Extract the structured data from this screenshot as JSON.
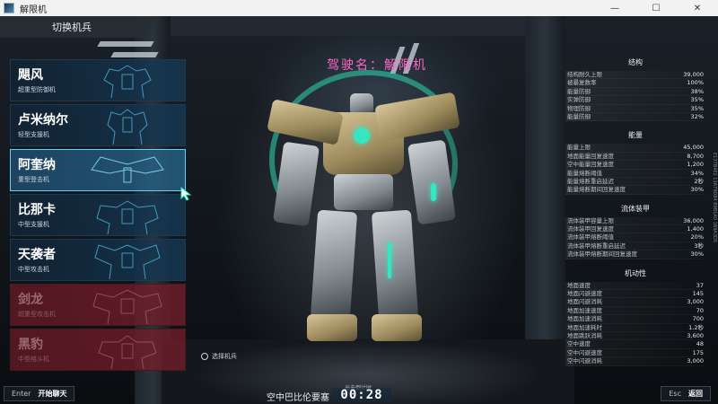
{
  "window": {
    "title": "解限机",
    "controls": [
      "—",
      "☐",
      "✕"
    ]
  },
  "left_panel": {
    "header": "切换机兵",
    "mechs": [
      {
        "name": "飓风",
        "sub": "超重型防御机",
        "state": "normal"
      },
      {
        "name": "卢米纳尔",
        "sub": "轻型支援机",
        "state": "normal"
      },
      {
        "name": "阿奎纳",
        "sub": "重型登击机",
        "state": "selected"
      },
      {
        "name": "比那卡",
        "sub": "中型支援机",
        "state": "normal"
      },
      {
        "name": "天袭者",
        "sub": "中型攻击机",
        "state": "normal"
      },
      {
        "name": "剑龙",
        "sub": "超重型攻击机",
        "state": "locked"
      },
      {
        "name": "黑豹",
        "sub": "中型格斗机",
        "state": "locked"
      }
    ]
  },
  "pilot_name": "驾驶名：解限机",
  "stats": {
    "groups": [
      {
        "title": "结构",
        "rows": [
          {
            "label": "结构耐久上限",
            "value": "39,000"
          },
          {
            "label": "被暴复数率",
            "value": "100%"
          },
          {
            "label": "能量防御",
            "value": "38%"
          },
          {
            "label": "实弹防御",
            "value": "35%"
          },
          {
            "label": "物理防御",
            "value": "35%"
          },
          {
            "label": "能量防御",
            "value": "32%"
          }
        ]
      },
      {
        "title": "能量",
        "rows": [
          {
            "label": "能量上限",
            "value": "45,000"
          },
          {
            "label": "地面能量回复速度",
            "value": "8,700"
          },
          {
            "label": "空中能量回复速度",
            "value": "1,200"
          },
          {
            "label": "能量熔断阈值",
            "value": "34%"
          },
          {
            "label": "能量熔断重启延迟",
            "value": "2秒"
          },
          {
            "label": "能量熔断期间回复速度",
            "value": "30%"
          }
        ]
      },
      {
        "title": "流体装甲",
        "rows": [
          {
            "label": "流体装甲容量上限",
            "value": "36,000"
          },
          {
            "label": "流体装甲回复速度",
            "value": "1,400"
          },
          {
            "label": "流体装甲熔断阈值",
            "value": "20%"
          },
          {
            "label": "流体装甲熔断重启延迟",
            "value": "3秒"
          },
          {
            "label": "流体装甲熔断期间回复速度",
            "value": "30%"
          }
        ]
      },
      {
        "title": "机动性",
        "rows": [
          {
            "label": "地面速度",
            "value": "37"
          },
          {
            "label": "地面闪避速度",
            "value": "145"
          },
          {
            "label": "地面闪避消耗",
            "value": "3,000"
          },
          {
            "label": "地面加速速度",
            "value": "70"
          },
          {
            "label": "地面加速消耗",
            "value": "700"
          },
          {
            "label": "地面加速耗时",
            "value": "1.2秒"
          },
          {
            "label": "地面跳跃消耗",
            "value": "3,600"
          },
          {
            "label": "空中速度",
            "value": "48"
          },
          {
            "label": "空中闪避速度",
            "value": "175"
          },
          {
            "label": "空中闪避消耗",
            "value": "3,000"
          }
        ]
      }
    ]
  },
  "side_code": "E137B4E2  13A79D84  B9B1A0  1B9A3D5",
  "bottom": {
    "left_key": "Enter",
    "left_action": "开始聊天",
    "select_hint": "选择机兵",
    "map_name": "空中巴比伦要塞",
    "countdown_label": "出击倒计时",
    "countdown": "00:28",
    "right_key": "Esc",
    "right_action": "返回"
  },
  "colors": {
    "accent": "#35e6c0",
    "selected": "#5fd0ff",
    "locked": "#7a1e2c",
    "pilot_name": "#ff66c4"
  }
}
